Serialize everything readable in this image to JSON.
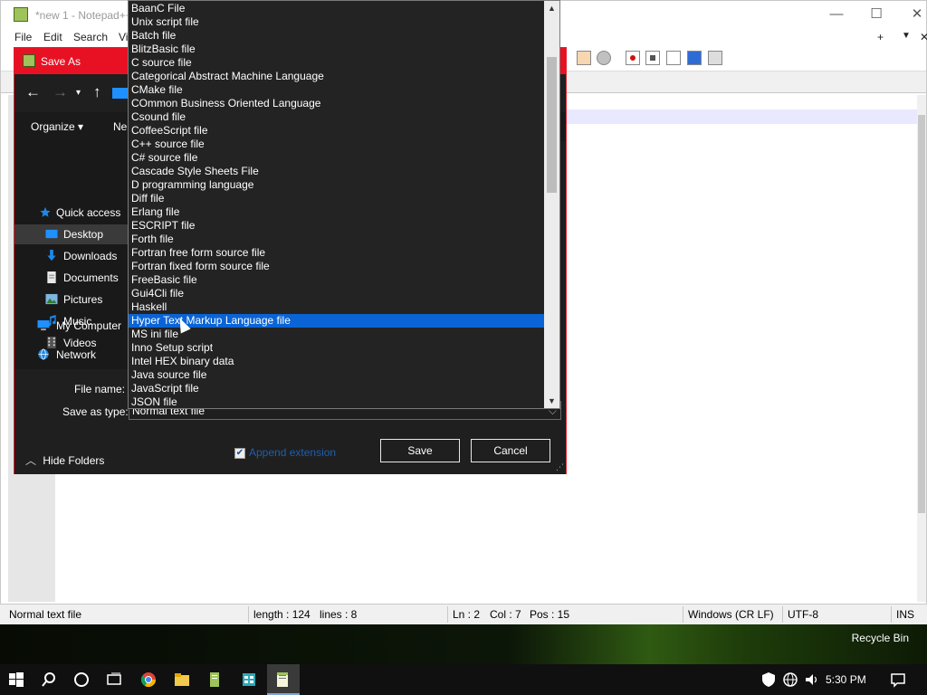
{
  "npp": {
    "title": "*new 1 - Notepad++",
    "menu": [
      "File",
      "Edit",
      "Search",
      "Vi"
    ],
    "window_buttons": {
      "minimize": "—",
      "maximize": "☐",
      "close": "✕"
    },
    "tab_buttons": {
      "add": "+",
      "dropdown": "▼",
      "close": "✕"
    }
  },
  "statusbar": {
    "file_type": "Normal text file",
    "length": "length : 124",
    "lines": "lines : 8",
    "ln": "Ln : 2",
    "col": "Col : 7",
    "pos": "Pos : 15",
    "eol": "Windows (CR LF)",
    "encoding": "UTF-8",
    "mode": "INS"
  },
  "desktop": {
    "recycle_bin": "Recycle Bin"
  },
  "taskbar": {
    "time": "5:30 PM"
  },
  "dialog": {
    "title": "Save As",
    "organize": "Organize ▾",
    "new_folder": "Ne",
    "nav": {
      "quick_access": "Quick access",
      "desktop": "Desktop",
      "downloads": "Downloads",
      "documents": "Documents",
      "pictures": "Pictures",
      "music": "Music",
      "videos": "Videos",
      "my_computer": "My Computer",
      "network": "Network"
    },
    "file_name_label": "File name:",
    "save_as_type_label": "Save as type:",
    "save_as_type_value": "Normal text file",
    "hide_folders": "Hide Folders",
    "append_extension": "Append extension",
    "append_checked": true,
    "save_button": "Save",
    "cancel_button": "Cancel"
  },
  "dropdown": {
    "selected": "Hyper Text Markup Language file",
    "items": [
      "BaanC File",
      "Unix script file",
      "Batch file",
      "BlitzBasic file",
      "C source file",
      "Categorical Abstract Machine Language",
      "CMake file",
      "COmmon Business Oriented Language",
      "Csound file",
      "CoffeeScript file",
      "C++ source file",
      "C# source file",
      "Cascade Style Sheets File",
      "D programming language",
      "Diff file",
      "Erlang file",
      "ESCRIPT file",
      "Forth file",
      "Fortran free form source file",
      "Fortran fixed form source file",
      "FreeBasic file",
      "Gui4Cli file",
      "Haskell",
      "Hyper Text Markup Language file",
      "MS ini file",
      "Inno Setup script",
      "Intel HEX binary data",
      "Java source file",
      "JavaScript file",
      "JSON file"
    ]
  }
}
